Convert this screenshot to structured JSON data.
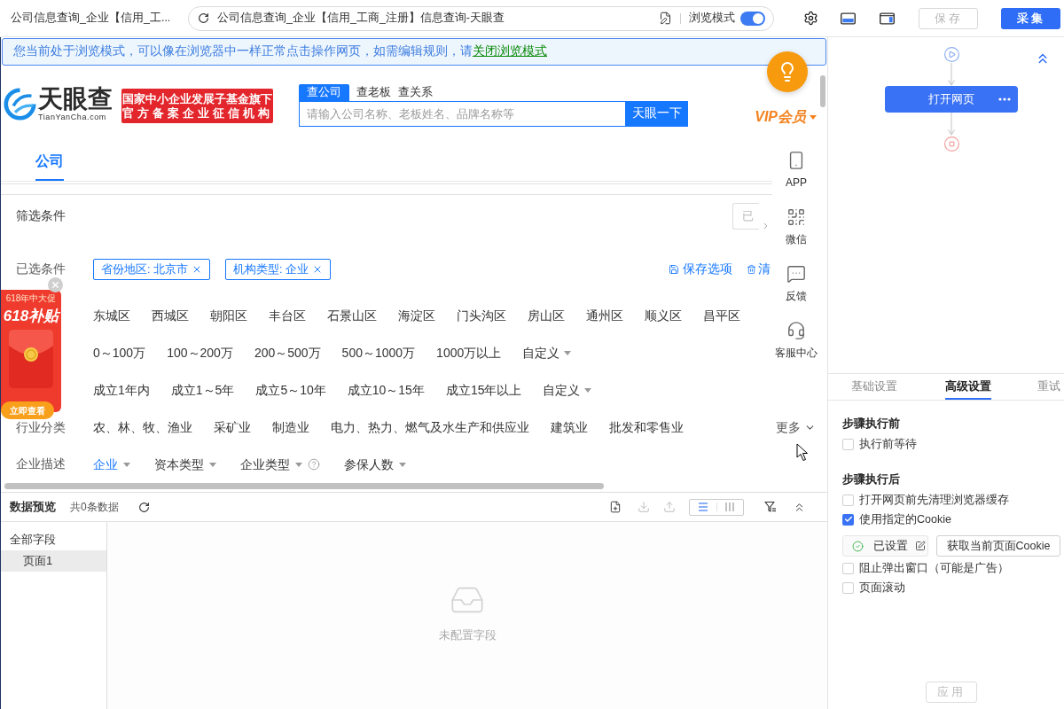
{
  "browser_tab": {
    "title": "公司信息查询_企业【信用_工..."
  },
  "address_bar": {
    "url": "公司信息查询_企业【信用_工商_注册】信息查询-天眼查",
    "mode_label": "浏览模式",
    "mode_on": true
  },
  "actions": [
    {
      "label": "保存",
      "kind": "secondary",
      "disabled": true
    },
    {
      "label": "采集",
      "kind": "primary",
      "disabled": false
    }
  ],
  "notice": {
    "text": "您当前处于浏览模式，可以像在浏览器中一样正常点击操作网页，如需编辑规则，请",
    "link": "关闭浏览模式"
  },
  "site": {
    "logo": {
      "name": "天眼查",
      "domain": "TianYanCha.com"
    },
    "banner": [
      "国家中小企业发展子基金旗下",
      "官方备案企业征信机构"
    ],
    "search_tabs": [
      {
        "label": "查公司",
        "selected": true
      },
      {
        "label": "查老板",
        "selected": false
      },
      {
        "label": "查关系",
        "selected": false
      }
    ],
    "search": {
      "placeholder": "请输入公司名称、老板姓名、品牌名称等",
      "button": "天眼一下"
    },
    "vip": "VIP会员",
    "result_tabs": [
      {
        "label": "公司",
        "selected": true
      }
    ],
    "filter_title": "筛选条件",
    "filter_button": "已",
    "selected_filters": {
      "label": "已选条件",
      "tags": [
        "省份地区: 北京市",
        "机构类型: 企业"
      ],
      "save": "保存选项",
      "clear": "清"
    },
    "filter_rows": [
      {
        "options": [
          {
            "label": "东城区",
            "selected": false
          },
          {
            "label": "西城区",
            "selected": false
          },
          {
            "label": "朝阳区",
            "selected": false
          },
          {
            "label": "丰台区",
            "selected": false
          },
          {
            "label": "石景山区",
            "selected": false
          },
          {
            "label": "海淀区",
            "selected": false
          },
          {
            "label": "门头沟区",
            "selected": false
          },
          {
            "label": "房山区",
            "selected": false
          },
          {
            "label": "通州区",
            "selected": false
          },
          {
            "label": "顺义区",
            "selected": false
          },
          {
            "label": "昌平区",
            "selected": false
          }
        ]
      },
      {
        "options": [
          {
            "label": "0～100万",
            "selected": false
          },
          {
            "label": "100～200万",
            "selected": false
          },
          {
            "label": "200～500万",
            "selected": false
          },
          {
            "label": "500～1000万",
            "selected": false
          },
          {
            "label": "1000万以上",
            "selected": false
          }
        ],
        "custom": "自定义"
      },
      {
        "options": [
          {
            "label": "成立1年内",
            "selected": false
          },
          {
            "label": "成立1～5年",
            "selected": false
          },
          {
            "label": "成立5～10年",
            "selected": false
          },
          {
            "label": "成立10～15年",
            "selected": false
          },
          {
            "label": "成立15年以上",
            "selected": false
          }
        ],
        "custom": "自定义"
      },
      {
        "label": "行业分类",
        "options": [
          {
            "label": "农、林、牧、渔业",
            "selected": false
          },
          {
            "label": "采矿业",
            "selected": false
          },
          {
            "label": "制造业",
            "selected": false
          },
          {
            "label": "电力、热力、燃气及水生产和供应业",
            "selected": false
          },
          {
            "label": "建筑业",
            "selected": false
          },
          {
            "label": "批发和零售业",
            "selected": false
          }
        ],
        "more": "更多"
      }
    ],
    "description_row": {
      "label": "企业描述",
      "dropdowns": [
        {
          "label": "企业",
          "selected": true,
          "help": false
        },
        {
          "label": "资本类型",
          "selected": false,
          "help": false
        },
        {
          "label": "企业类型",
          "selected": false,
          "help": true
        },
        {
          "label": "参保人数",
          "selected": false,
          "help": false
        }
      ]
    },
    "side_tools": [
      {
        "label": "APP"
      },
      {
        "label": "微信"
      },
      {
        "label": "反馈"
      },
      {
        "label": "客服中心"
      }
    ],
    "ad": {
      "tag": "618年中大促",
      "title": "618补贴",
      "button": "立即查看"
    }
  },
  "preview": {
    "title": "数据预览",
    "count": "共0条数据",
    "tools": [
      {
        "disabled": false
      },
      {
        "disabled": true
      },
      {
        "disabled": true
      }
    ],
    "view_modes": [
      {
        "selected": true
      },
      {
        "selected": false
      }
    ],
    "fields": [
      {
        "label": "全部字段",
        "selected": false,
        "children": [
          {
            "label": "页面1",
            "selected": true
          }
        ]
      }
    ],
    "empty": "未配置字段"
  },
  "step_panel": {
    "node": {
      "label": "打开网页"
    },
    "tabs": [
      {
        "label": "基础设置",
        "selected": false
      },
      {
        "label": "高级设置",
        "selected": true
      },
      {
        "label": "重试",
        "selected": false
      }
    ],
    "sections": [
      {
        "title": "步骤执行前",
        "items": [
          {
            "kind": "checkbox",
            "label": "执行前等待",
            "checked": false
          }
        ]
      },
      {
        "title": "步骤执行后",
        "items": [
          {
            "kind": "checkbox",
            "label": "打开网页前先清理浏览器缓存",
            "checked": false
          },
          {
            "kind": "checkbox",
            "label": "使用指定的Cookie",
            "checked": true
          },
          {
            "kind": "cookie",
            "status": "已设置",
            "button": "获取当前页面Cookie"
          },
          {
            "kind": "checkbox",
            "label": "阻止弹出窗口（可能是广告）",
            "checked": false
          },
          {
            "kind": "checkbox",
            "label": "页面滚动",
            "checked": false
          }
        ]
      }
    ],
    "apply": {
      "label": "应用",
      "disabled": true
    }
  }
}
